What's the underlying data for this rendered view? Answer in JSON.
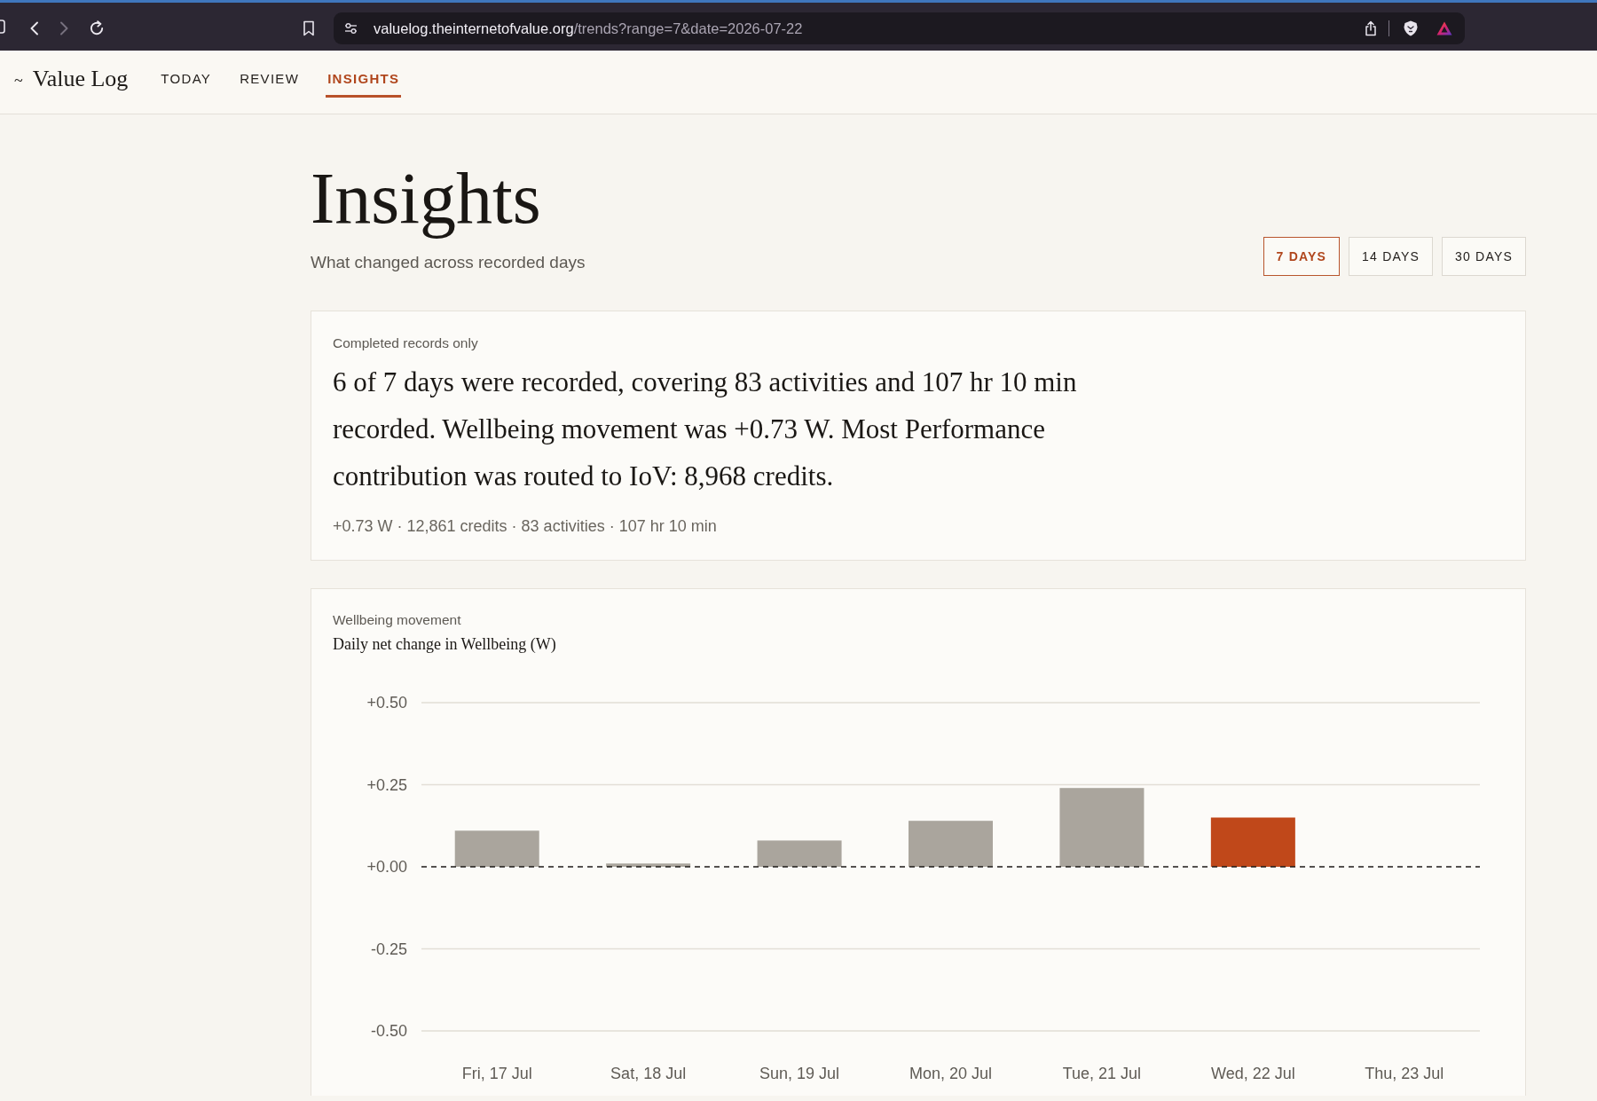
{
  "browser": {
    "nav_buttons": [
      {
        "kind": "back",
        "disabled": false
      },
      {
        "kind": "forward",
        "disabled": true
      },
      {
        "kind": "reload",
        "disabled": false
      }
    ],
    "address": {
      "host": "valuelog.theinternetofvalue.org",
      "path": "/trends?range=7&date=2026-07-22"
    }
  },
  "app_nav": {
    "logo": {
      "mark": "~",
      "name": "Value Log"
    },
    "tabs": [
      {
        "label": "TODAY",
        "selected": false
      },
      {
        "label": "REVIEW",
        "selected": false
      },
      {
        "label": "INSIGHTS",
        "selected": true
      }
    ]
  },
  "header": {
    "title": "Insights",
    "subtitle": "What changed across recorded days",
    "ranges": [
      {
        "label": "7 DAYS",
        "selected": true
      },
      {
        "label": "14 DAYS",
        "selected": false
      },
      {
        "label": "30 DAYS",
        "selected": false
      }
    ]
  },
  "summary": {
    "eyebrow": "Completed records only",
    "text": "6 of 7 days were recorded, covering 83 activities and 107 hr 10 min recorded. Wellbeing movement was +0.73 W. Most Performance contribution was routed to IoV: 8,968 credits.",
    "stats": "+0.73 W · 12,861 credits · 83 activities · 107 hr 10 min"
  },
  "wellbeing_chart": {
    "eyebrow": "Wellbeing movement",
    "chart_data": {
      "type": "bar",
      "title": "Daily net change in Wellbeing (W)",
      "categories": [
        "Fri, 17 Jul",
        "Sat, 18 Jul",
        "Sun, 19 Jul",
        "Mon, 20 Jul",
        "Tue, 21 Jul",
        "Wed, 22 Jul",
        "Thu, 23 Jul"
      ],
      "series": [
        {
          "color": "#aaa59d",
          "values": [
            0.11,
            0.01,
            0.08,
            0.14,
            0.24,
            null,
            null
          ]
        },
        {
          "color": "#c0481a",
          "values": [
            null,
            null,
            null,
            null,
            null,
            0.15,
            null
          ]
        }
      ],
      "ylim": [
        -0.5,
        0.5
      ],
      "yticks": [
        {
          "value": 0.5,
          "label": "+0.50"
        },
        {
          "value": 0.25,
          "label": "+0.25"
        },
        {
          "value": 0,
          "label": "+0.00"
        },
        {
          "value": -0.25,
          "label": "-0.25"
        },
        {
          "value": -0.5,
          "label": "-0.50"
        }
      ],
      "ref_lines": [
        {
          "axis": "y",
          "value": 0
        }
      ]
    }
  }
}
